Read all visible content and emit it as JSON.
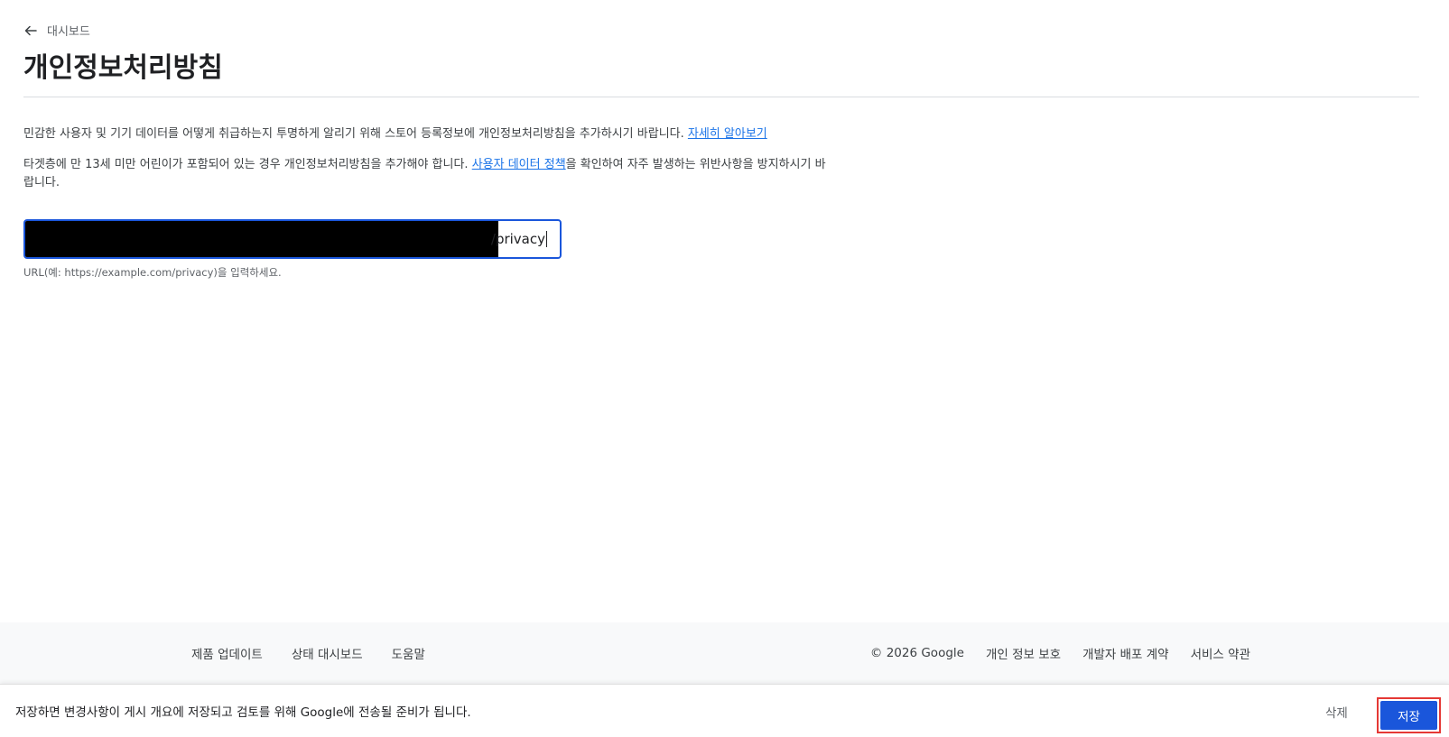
{
  "header": {
    "back_label": "대시보드",
    "title": "개인정보처리방침"
  },
  "intro": {
    "para1_text": "민감한 사용자 및 기기 데이터를 어떻게 취급하는지 투명하게 알리기 위해 스토어 등록정보에 개인정보처리방침을 추가하시기 바랍니다. ",
    "para1_link": "자세히 알아보기",
    "para2_text_before": "타겟층에 만 13세 미만 어린이가 포함되어 있는 경우 개인정보처리방침을 추가해야 합니다. ",
    "para2_link": "사용자 데이터 정책",
    "para2_text_after": "을 확인하여 자주 발생하는 위반사항을 방지하시기 바랍니다."
  },
  "url_input": {
    "visible_value": "/privacy",
    "helper": "URL(예: https://example.com/privacy)을 입력하세요."
  },
  "footer": {
    "left_links": [
      "제품 업데이트",
      "상태 대시보드",
      "도움말"
    ],
    "copyright": "© 2026 Google",
    "right_links": [
      "개인 정보 보호",
      "개발자 배포 계약",
      "서비스 약관"
    ]
  },
  "save_bar": {
    "message": "저장하면 변경사항이 게시 개요에 저장되고 검토를 위해 Google에 전송될 준비가 됩니다.",
    "delete_label": "삭제",
    "save_label": "저장"
  },
  "colors": {
    "primary": "#1a56db",
    "link": "#1a73e8",
    "highlight": "#e53935"
  }
}
